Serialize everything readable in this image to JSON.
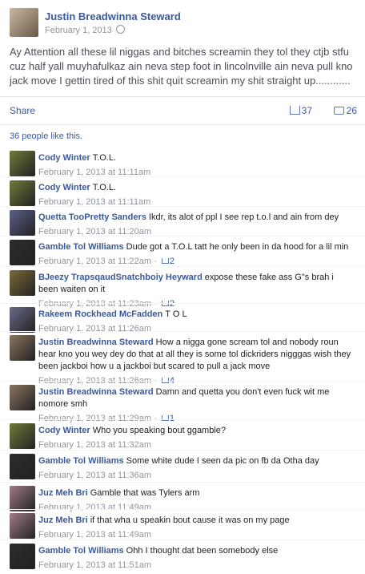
{
  "post": {
    "author": "Justin Breadwinna Steward",
    "date": "February 1, 2013",
    "body": "Ay Attention all these lil niggas and bitches screamin they tol they ctjb stfu cuz half yall muyhafulkaz ain neva step foot in lincolnville ain neva pull kno jack move I gettin tired of this shit quit screamin my shit straight up............",
    "share_label": "Share",
    "likes": "37",
    "comments": "26",
    "like_summary": "36 people like this."
  },
  "comments": [
    {
      "author": "Cody Winter",
      "text": "T.O.L.",
      "time": "February 1, 2013 at 11:11am",
      "likes": "",
      "avatar_color": "#6e7b3a"
    },
    {
      "author": "Cody Winter",
      "text": "T.O.L.",
      "time": "February 1, 2013 at 11:11am",
      "likes": "",
      "avatar_color": "#6e7b3a"
    },
    {
      "author": "Quetta TooPretty Sanders",
      "text": "Ikdr, its alot of ppl I see rep t.o.l and ain from dey",
      "time": "February 1, 2013 at 11:20am",
      "likes": "",
      "avatar_color": "#5a5f8a"
    },
    {
      "author": "Gamble Tol Williams",
      "text": "Dude got a T.O.L tatt he only been in da hood for a lil min",
      "time": "February 1, 2013 at 11:22am",
      "likes": "2",
      "avatar_color": "#2c2c2c"
    },
    {
      "author": "BJeezy TrapsqaudSnatchboiy Heyward",
      "text": "expose these fake ass G\"s brah i been waiten on it",
      "time": "February 1, 2013 at 11:23am",
      "likes": "2",
      "avatar_color": "#7a6a3a"
    },
    {
      "author": "Rakeem Rockhead McFadden",
      "text": "T O L",
      "time": "February 1, 2013 at 11:26am",
      "likes": "",
      "avatar_color": "#6a6a8a"
    },
    {
      "author": "Justin Breadwinna Steward",
      "text": "How a nigga gone scream tol and nobody roun hear kno you wey dey do that at all they is some tol dickriders nigggas wish they been jackboi how u a jackboi but scared to pull a jack move",
      "time": "February 1, 2013 at 11:26am",
      "likes": "4",
      "avatar_color": "#8a7460"
    },
    {
      "author": "Justin Breadwinna Steward",
      "text": "Damn and quetta you don't even fuck wit me nomore smh",
      "time": "February 1, 2013 at 11:29am",
      "likes": "1",
      "avatar_color": "#8a7460"
    },
    {
      "author": "Cody Winter",
      "text": "Who you speaking bout ggamble?",
      "time": "February 1, 2013 at 11:32am",
      "likes": "",
      "avatar_color": "#6e7b3a"
    },
    {
      "author": "Gamble Tol Williams",
      "text": "Some white dude I seen da pic on fb da Otha day",
      "time": "February 1, 2013 at 11:36am",
      "likes": "",
      "avatar_color": "#2c2c2c"
    },
    {
      "author": "Juz Meh Bri",
      "text": "Gamble that was Tylers arm",
      "time": "February 1, 2013 at 11:49am",
      "likes": "",
      "avatar_color": "#a07a8a"
    },
    {
      "author": "Juz Meh Bri",
      "text": "if that wha u speakin bout cause it was on my page",
      "time": "February 1, 2013 at 11:49am",
      "likes": "",
      "avatar_color": "#a07a8a"
    },
    {
      "author": "Gamble Tol Williams",
      "text": "Ohh I thought dat been somebody else",
      "time": "February 1, 2013 at 11:51am",
      "likes": "",
      "avatar_color": "#2c2c2c"
    }
  ]
}
